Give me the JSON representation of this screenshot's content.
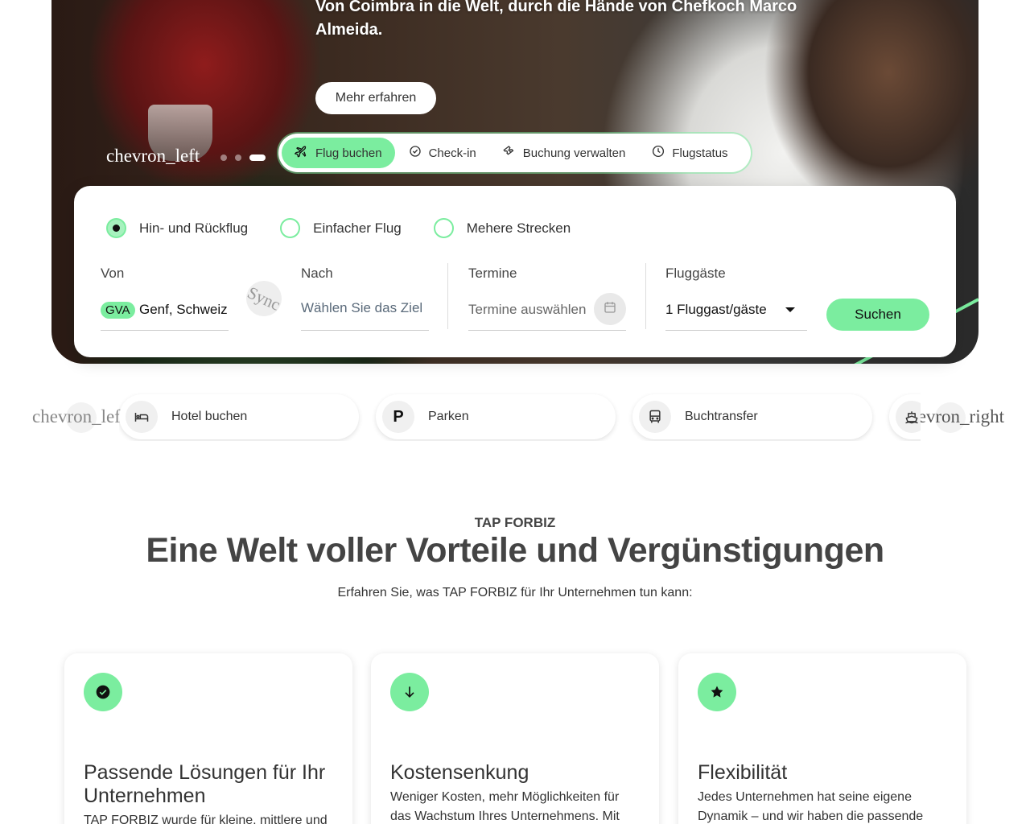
{
  "hero": {
    "tagline": "Von Coimbra in die Welt, durch die Hände von Chefkoch Marco Almeida.",
    "cta_label": "Mehr erfahren",
    "prev_label": "chevron_left",
    "slide_count": 3,
    "active_slide": 3
  },
  "tabs": [
    {
      "label": "Flug buchen",
      "icon": "plane-icon",
      "active": true
    },
    {
      "label": "Check-in",
      "icon": "check-circle-icon",
      "active": false
    },
    {
      "label": "Buchung verwalten",
      "icon": "ticket-icon",
      "active": false
    },
    {
      "label": "Flugstatus",
      "icon": "clock-icon",
      "active": false
    }
  ],
  "booking": {
    "trip_types": [
      {
        "label": "Hin- und Rückflug",
        "selected": true
      },
      {
        "label": "Einfacher Flug",
        "selected": false
      },
      {
        "label": "Mehere Strecken",
        "selected": false
      }
    ],
    "from_label": "Von",
    "from_code": "GVA",
    "from_city": "Genf, Schweiz",
    "swap_label": "Sync",
    "to_label": "Nach",
    "to_placeholder": "Wählen Sie das Ziel",
    "dates_label": "Termine",
    "dates_placeholder": "Termine auswählen",
    "passengers_label": "Fluggäste",
    "passengers_value": "1 Fluggast/gäste",
    "search_label": "Suchen"
  },
  "services": {
    "prev_label": "chevron_left",
    "next_label": "chevron_right",
    "items": [
      {
        "label": "Hotel buchen",
        "icon": "bed-icon"
      },
      {
        "label": "Parken",
        "icon": "parking-icon",
        "glyph": "P"
      },
      {
        "label": "Buchtransfer",
        "icon": "bus-icon"
      },
      {
        "label": "",
        "icon": "ship-icon"
      }
    ]
  },
  "forbiz": {
    "eyebrow": "TAP FORBIZ",
    "headline": "Eine Welt voller Vorteile und Vergünstigungen",
    "subline": "Erfahren Sie, was TAP FORBIZ für Ihr Unternehmen tun kann:",
    "features": [
      {
        "icon": "check-circle-icon",
        "title": "Passende Lösungen für Ihr Unternehmen",
        "text": "TAP FORBIZ wurde für kleine, mittlere und große Unternehmen entwickelt und"
      },
      {
        "icon": "arrow-down-icon",
        "title": "Kostensenkung",
        "text": "Weniger Kosten, mehr Möglichkeiten für das Wachstum Ihres Unternehmens. Mit exklusiven Rabatten und Vorteilen, die"
      },
      {
        "icon": "star-icon",
        "title": "Flexibilität",
        "text": "Jedes Unternehmen hat seine eigene Dynamik – und wir haben die passende Lösung, um mit Ihrem Tempo Schritt zu"
      }
    ]
  },
  "colors": {
    "accent": "#7bed9f",
    "text": "#333333"
  }
}
